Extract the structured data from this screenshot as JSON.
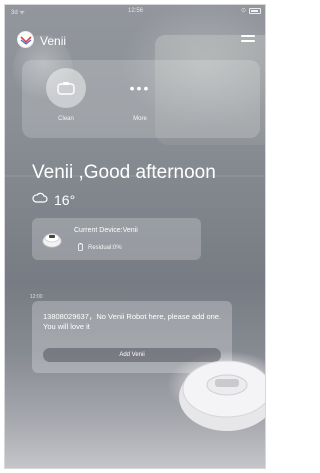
{
  "status_bar": {
    "carrier": "3d ᯤ",
    "time": "12:56",
    "battery_label": "◀"
  },
  "app_bar": {
    "title": "Venii"
  },
  "quick_actions": [
    {
      "label": "Clean",
      "icon": "robot-icon"
    },
    {
      "label": "More",
      "icon": "more-dots-icon"
    }
  ],
  "greeting": "Venii ,Good afternoon",
  "weather": {
    "icon": "cloud-icon",
    "temperature": "16°"
  },
  "device": {
    "name": "Current Device:Venii",
    "residual": "Residual:0%",
    "icon": "vacuum-icon",
    "battery_icon": "battery-icon"
  },
  "message": {
    "time": "12:00",
    "text": "13808029637，No Venii Robot here, please add one. You will love it",
    "button_label": "Add Venii"
  },
  "colors": {
    "overlay": "#ffffff",
    "button": "#55555f"
  }
}
